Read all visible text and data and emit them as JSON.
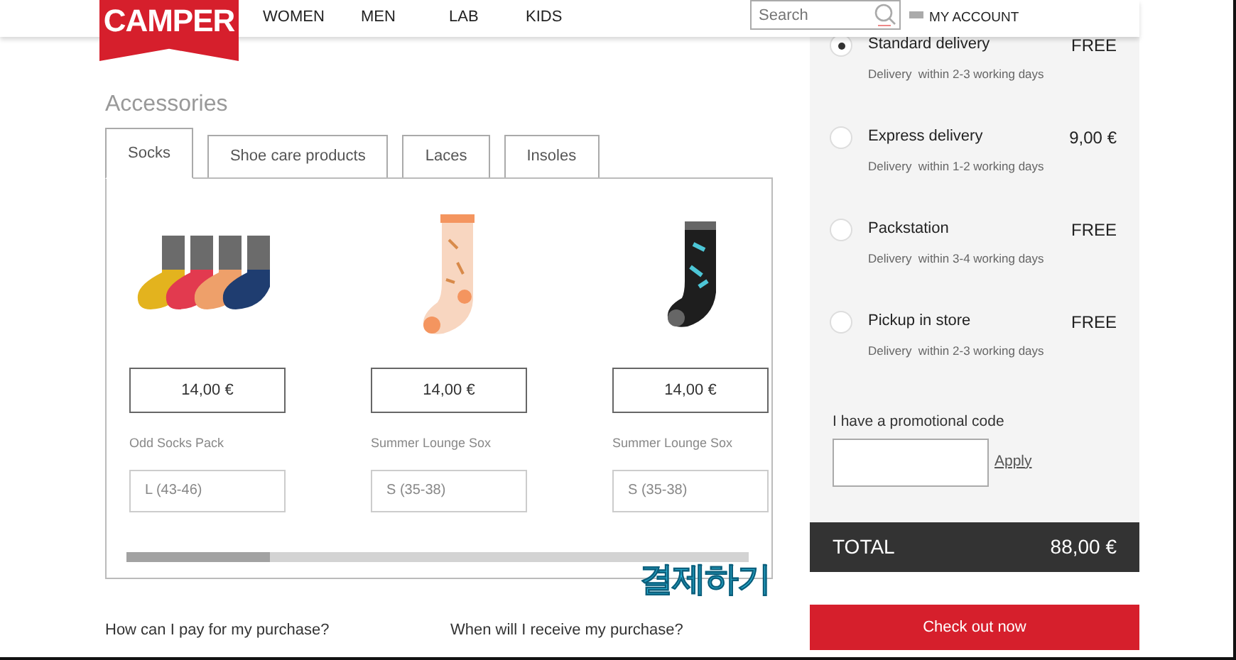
{
  "header": {
    "logo": "CAMPER",
    "nav": [
      "WOMEN",
      "MEN",
      "LAB",
      "KIDS"
    ],
    "search": {
      "placeholder": "Search"
    },
    "account": "MY ACCOUNT"
  },
  "accessories": {
    "title": "Accessories",
    "tabs": [
      {
        "label": "Socks",
        "selected": true
      },
      {
        "label": "Shoe care products",
        "selected": false
      },
      {
        "label": "Laces",
        "selected": false
      },
      {
        "label": "Insoles",
        "selected": false
      }
    ],
    "products": [
      {
        "price": "14,00 €",
        "name": "Odd Socks Pack",
        "size": "L (43-46)"
      },
      {
        "price": "14,00 €",
        "name": "Summer Lounge Sox",
        "size": "S (35-38)"
      },
      {
        "price": "14,00 €",
        "name": "Summer Lounge Sox",
        "size": "S (35-38)"
      }
    ]
  },
  "overlay_caption": "결제하기",
  "faq": [
    "How can I pay for my purchase?",
    "When will I receive my purchase?"
  ],
  "delivery_options": [
    {
      "name": "Standard delivery",
      "detail": "Delivery  within 2-3 working days",
      "price": "FREE",
      "selected": true
    },
    {
      "name": "Express delivery",
      "detail": "Delivery  within 1-2 working days",
      "price": "9,00 €",
      "selected": false
    },
    {
      "name": "Packstation",
      "detail": "Delivery  within 3-4 working days",
      "price": "FREE",
      "selected": false
    },
    {
      "name": "Pickup in store",
      "detail": "Delivery  within 2-3 working days",
      "price": "FREE",
      "selected": false
    }
  ],
  "promo": {
    "label": "I have a promotional code",
    "apply": "Apply"
  },
  "total": {
    "label": "TOTAL",
    "amount": "88,00 €"
  },
  "checkout": "Check out now"
}
